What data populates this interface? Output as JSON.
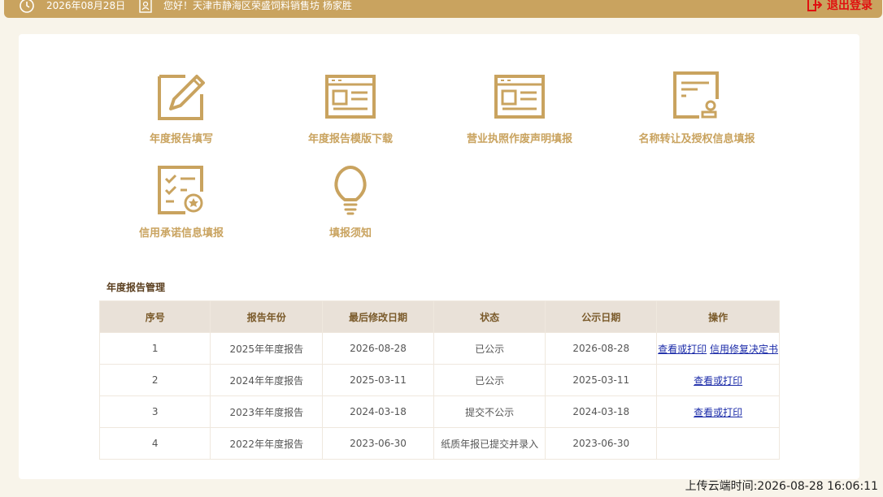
{
  "topbar": {
    "date": "2026年08月28日",
    "greeting": "您好！天津市静海区荣盛饲料销售坊  杨家胜",
    "logout_label": "退出登录"
  },
  "tiles": [
    {
      "label": "年度报告填写",
      "icon": "pencil-form-icon"
    },
    {
      "label": "年度报告模版下载",
      "icon": "template-doc-icon"
    },
    {
      "label": "营业执照作废声明填报",
      "icon": "license-doc-icon"
    },
    {
      "label": "名称转让及授权信息填报",
      "icon": "certificate-stamp-icon"
    },
    {
      "label": "信用承诺信息填报",
      "icon": "checklist-badge-icon"
    },
    {
      "label": "填报须知",
      "icon": "lightbulb-icon"
    }
  ],
  "section_title": "年度报告管理",
  "table": {
    "headers": [
      "序号",
      "报告年份",
      "最后修改日期",
      "状态",
      "公示日期",
      "操作"
    ],
    "rows": [
      {
        "no": "1",
        "year": "2025年年度报告",
        "modified": "2026-08-28",
        "status": "已公示",
        "publish": "2026-08-28",
        "actions": [
          "查看或打印",
          "信用修复决定书"
        ]
      },
      {
        "no": "2",
        "year": "2024年年度报告",
        "modified": "2025-03-11",
        "status": "已公示",
        "publish": "2025-03-11",
        "actions": [
          "查看或打印"
        ]
      },
      {
        "no": "3",
        "year": "2023年年度报告",
        "modified": "2024-03-18",
        "status": "提交不公示",
        "publish": "2024-03-18",
        "actions": [
          "查看或打印"
        ]
      },
      {
        "no": "4",
        "year": "2022年年度报告",
        "modified": "2023-06-30",
        "status": "纸质年报已提交并录入",
        "publish": "2023-06-30",
        "actions": []
      }
    ]
  },
  "upload_time": "上传云端时间:2026-08-28 16:06:11",
  "colors": {
    "accent": "#c9a35f",
    "logout": "#e01010",
    "link": "#1a2aa8",
    "header_bg": "#e9e1d8"
  }
}
